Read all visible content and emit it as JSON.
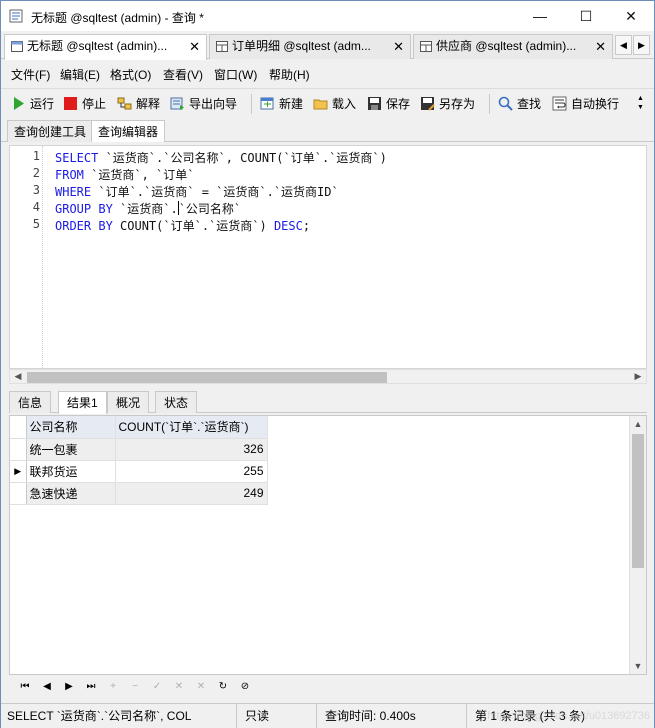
{
  "window": {
    "title": "无标题 @sqltest (admin) - 查询 *",
    "controls": {
      "minimize": "—",
      "maximize": "☐",
      "close": "✕"
    }
  },
  "doc_tabs": [
    {
      "label": "无标题 @sqltest (admin)...",
      "close": "✕",
      "active": true
    },
    {
      "label": "订单明细 @sqltest (adm...",
      "close": "✕",
      "active": false
    },
    {
      "label": "供应商 @sqltest (admin)...",
      "close": "✕",
      "active": false
    }
  ],
  "tab_scroll": {
    "left": "◀",
    "right": "▶"
  },
  "menu": [
    "文件(F)",
    "编辑(E)",
    "格式(O)",
    "查看(V)",
    "窗口(W)",
    "帮助(H)"
  ],
  "toolbar": {
    "run": "运行",
    "stop": "停止",
    "explain": "解释",
    "export_wizard": "导出向导",
    "new": "新建",
    "load": "载入",
    "save": "保存",
    "save_as": "另存为",
    "find": "查找",
    "word_wrap": "自动换行",
    "more": "▲▼"
  },
  "sub_tabs": [
    "查询创建工具",
    "查询编辑器"
  ],
  "editor": {
    "line_numbers": [
      "1",
      "2",
      "3",
      "4",
      "5"
    ],
    "lines": [
      {
        "kw": "SELECT",
        "rest": " `运货商`.`公司名称`, COUNT(`订单`.`运货商`)"
      },
      {
        "kw": "FROM",
        "rest": " `运货商`, `订单`"
      },
      {
        "kw": "WHERE",
        "rest": " `订单`.`运货商` = `运货商`.`运货商ID`"
      },
      {
        "kw": "GROUP BY",
        "rest_a": " `运货商`.",
        "rest_b": "`公司名称`"
      },
      {
        "kw": "ORDER BY",
        "rest": " COUNT(`订单`.`运货商`) ",
        "kw2": "DESC",
        "tail": ";"
      }
    ]
  },
  "result_tabs": [
    "信息",
    "结果1",
    "概况",
    "状态"
  ],
  "grid": {
    "columns": [
      "公司名称",
      "COUNT(`订单`.`运货商`)"
    ],
    "rows": [
      {
        "name": "统一包裹",
        "count": "326",
        "current": false
      },
      {
        "name": "联邦货运",
        "count": "255",
        "current": true
      },
      {
        "name": "急速快递",
        "count": "249",
        "current": false
      }
    ],
    "row_marker": "▶"
  },
  "navigator": {
    "first": "⏮",
    "prev": "◀",
    "next": "▶",
    "last": "⏭",
    "add": "+",
    "delete": "−",
    "apply": "✓",
    "discard": "✕",
    "refresh": "↻",
    "stop": "⊘"
  },
  "status": {
    "sql": "SELECT `运货商`.`公司名称`, COL",
    "mode": "只读",
    "time": "查询时间: 0.400s",
    "records": "第 1 条记录 (共 3 条)",
    "watermark": "https://blog.csdn.net/u013692736"
  }
}
